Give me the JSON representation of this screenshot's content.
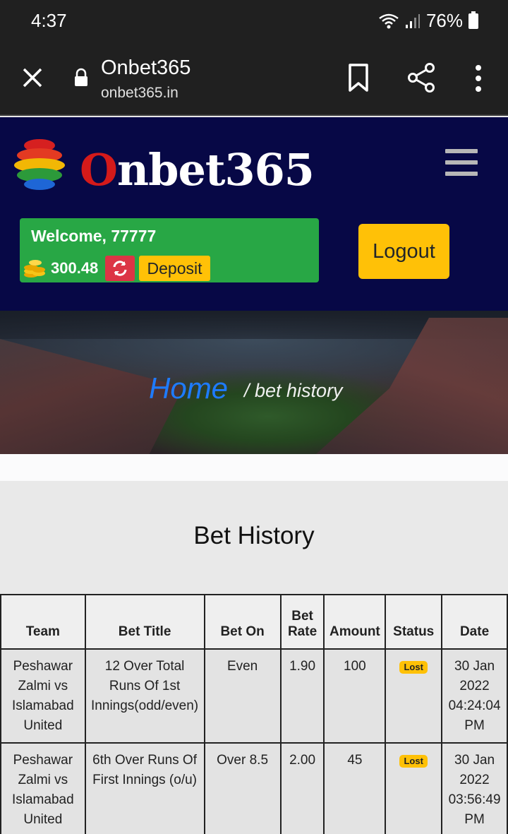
{
  "status_bar": {
    "time": "4:37",
    "battery": "76%"
  },
  "browser": {
    "title": "Onbet365",
    "url": "onbet365.in"
  },
  "site": {
    "logo_text_o": "O",
    "logo_text_rest": "nbet365",
    "welcome": "Welcome, 77777",
    "balance": "300.48",
    "deposit_label": "Deposit",
    "logout_label": "Logout"
  },
  "banner": {
    "home": "Home",
    "crumb": "/ bet history"
  },
  "main": {
    "title": "Bet History",
    "columns": [
      "Team",
      "Bet Title",
      "Bet On",
      "Bet Rate",
      "Amount",
      "Status",
      "Date"
    ],
    "rows": [
      {
        "team": "Peshawar Zalmi vs Islamabad United",
        "bet_title": "12 Over Total Runs Of 1st Innings(odd/even)",
        "bet_on": "Even",
        "rate": "1.90",
        "amount": "100",
        "status": "Lost",
        "date": "30 Jan 2022 04:24:04 PM"
      },
      {
        "team": "Peshawar Zalmi vs Islamabad United",
        "bet_title": "6th Over Runs Of First Innings (o/u)",
        "bet_on": "Over 8.5",
        "rate": "2.00",
        "amount": "45",
        "status": "Lost",
        "date": "30 Jan 2022 03:56:49 PM"
      }
    ]
  },
  "colors": {
    "header_bg": "#070846",
    "welcome_green": "#28a745",
    "accent_yellow": "#ffc107",
    "refresh_red": "#dc3545",
    "home_blue": "#1e7bff"
  }
}
